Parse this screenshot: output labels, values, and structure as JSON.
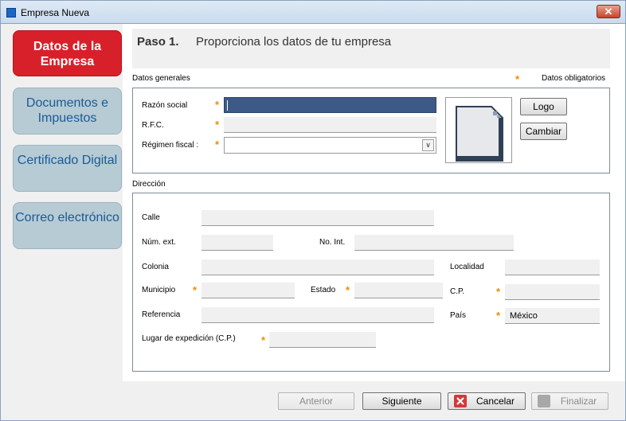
{
  "window": {
    "title": "Empresa Nueva",
    "close_glyph": "✕"
  },
  "steps": [
    {
      "label": "Datos de la Empresa",
      "active": true
    },
    {
      "label": "Documentos e Impuestos",
      "active": false
    },
    {
      "label": "Certificado Digital",
      "active": false
    },
    {
      "label": "Correo electrónico",
      "active": false
    }
  ],
  "header": {
    "step": "Paso 1.",
    "description": "Proporciona los datos de tu empresa"
  },
  "required_note": {
    "marker": "*",
    "label": "Datos obligatorios"
  },
  "datos_generales": {
    "title": "Datos generales",
    "razon_social": {
      "label": "Razón social",
      "value": ""
    },
    "rfc": {
      "label": "R.F.C.",
      "value": ""
    },
    "regimen": {
      "label": "Régimen fiscal :",
      "value": ""
    },
    "logo_button": "Logo",
    "cambiar_button": "Cambiar"
  },
  "direccion": {
    "title": "Dirección",
    "calle": {
      "label": "Calle",
      "value": ""
    },
    "num_ext": {
      "label": "Núm. ext.",
      "value": ""
    },
    "no_int": {
      "label": "No. Int.",
      "value": ""
    },
    "colonia": {
      "label": "Colonia",
      "value": ""
    },
    "localidad": {
      "label": "Localidad",
      "value": ""
    },
    "municipio": {
      "label": "Municipio",
      "value": ""
    },
    "estado": {
      "label": "Estado",
      "value": ""
    },
    "cp": {
      "label": "C.P.",
      "value": ""
    },
    "referencia": {
      "label": "Referencia",
      "value": ""
    },
    "pais": {
      "label": "País",
      "value": "México"
    },
    "lugar_expedicion": {
      "label": "Lugar de expedición (C.P.)",
      "value": ""
    }
  },
  "footer": {
    "anterior": "Anterior",
    "siguiente": "Siguiente",
    "cancelar": "Cancelar",
    "finalizar": "Finalizar"
  },
  "colors": {
    "active_step": "#d8202a",
    "inactive_step": "#b7cbd4",
    "required_star": "#f08a00"
  }
}
